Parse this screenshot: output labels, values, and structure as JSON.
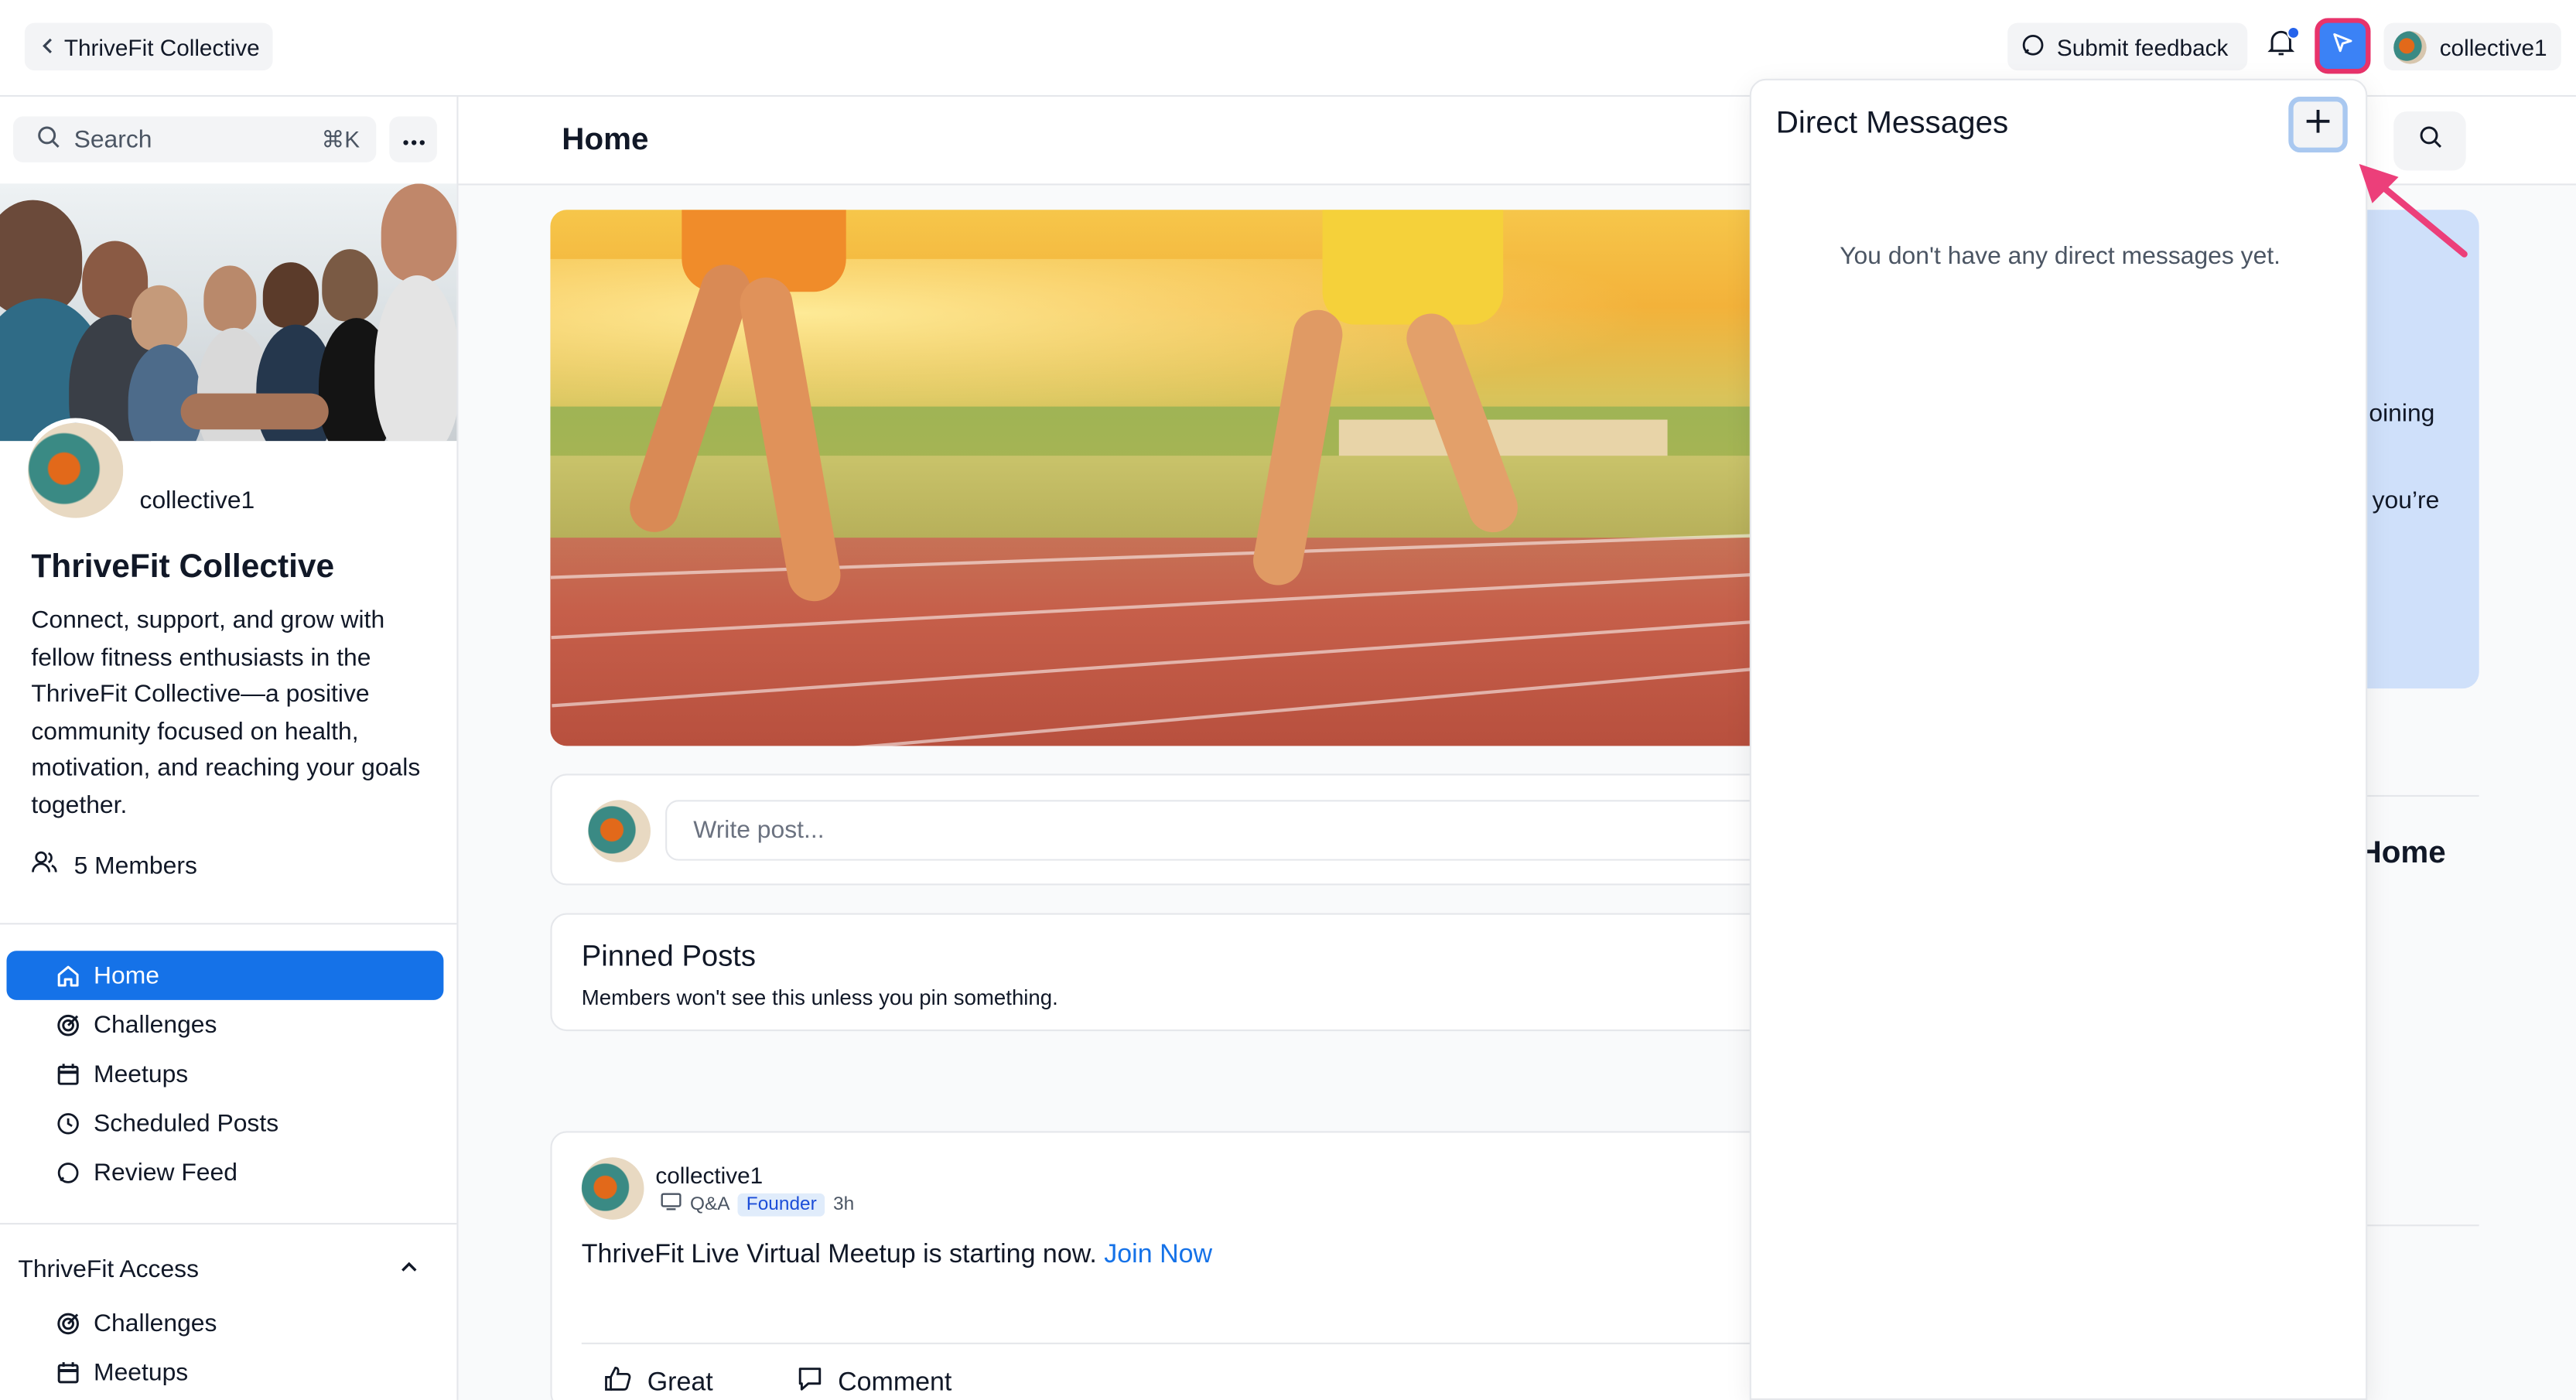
{
  "topbar": {
    "back_label": "ThriveFit Collective",
    "feedback_label": "Submit feedback",
    "user_label": "collective1"
  },
  "sidebar": {
    "search_placeholder": "Search",
    "search_shortcut": "⌘K",
    "handle": "collective1",
    "community_title": "ThriveFit Collective",
    "community_description": "Connect, support, and grow with fellow fitness enthusiasts in the ThriveFit Collective—a positive community focused on health, motivation, and reaching your goals together.",
    "members_label": "5 Members",
    "nav_items": [
      {
        "label": "Home",
        "icon": "home-icon",
        "active": true
      },
      {
        "label": "Challenges",
        "icon": "target-icon"
      },
      {
        "label": "Meetups",
        "icon": "calendar-icon"
      },
      {
        "label": "Scheduled Posts",
        "icon": "clock-icon"
      },
      {
        "label": "Review Feed",
        "icon": "chat-icon"
      }
    ],
    "group_title": "ThriveFit Access",
    "group_items": [
      {
        "label": "Challenges",
        "icon": "target-icon"
      },
      {
        "label": "Meetups",
        "icon": "calendar-icon"
      }
    ]
  },
  "main": {
    "page_title": "Home",
    "write_placeholder": "Write post...",
    "pinned_title": "Pinned Posts",
    "pinned_subtitle": "Members won't see this unless you pin something.",
    "post": {
      "author": "collective1",
      "category": "Q&A",
      "badge": "Founder",
      "time": "3h",
      "text": "ThriveFit Live Virtual Meetup is starting now.",
      "link": "Join Now",
      "action_great": "Great",
      "action_comment": "Comment"
    },
    "right_fragments": {
      "line1": "oining",
      "line2": "you’re",
      "home": "Home"
    }
  },
  "dm_panel": {
    "title": "Direct Messages",
    "empty_text": "You don't have any direct messages yet."
  },
  "colors": {
    "accent": "#1572e8",
    "highlight": "#e8336b",
    "dm_button": "#3b82f6"
  }
}
